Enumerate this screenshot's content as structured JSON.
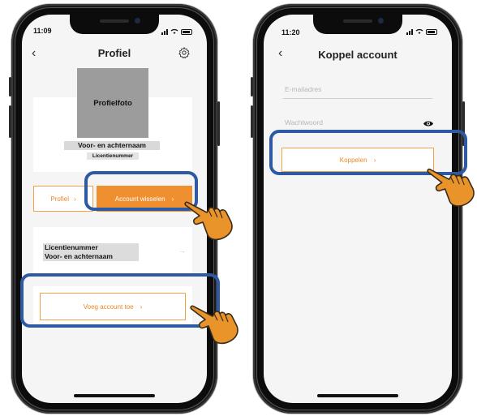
{
  "left_phone": {
    "status": {
      "time": "11:09"
    },
    "nav": {
      "title": "Profiel",
      "back_icon": "chevron-left-icon",
      "settings_icon": "gear-icon"
    },
    "profile": {
      "photo_label": "Profielfoto",
      "name": "Voor- en achternaam",
      "license": "Licentienummer"
    },
    "buttons": {
      "profile": "Profiel",
      "switch_account": "Account wisselen",
      "add_account": "Voeg account toe"
    },
    "account_row": {
      "license": "Licentienummer",
      "name": "Voor- en achternaam"
    }
  },
  "right_phone": {
    "status": {
      "time": "11:20"
    },
    "nav": {
      "title": "Koppel account",
      "back_icon": "chevron-left-icon"
    },
    "form": {
      "email_placeholder": "E-mailadres",
      "password_placeholder": "Wachtwoord",
      "eye_icon": "eye-icon",
      "submit": "Koppelen"
    }
  },
  "colors": {
    "accent": "#ef8f2f",
    "highlight": "#2d5aa3",
    "hand": "#e9942b"
  }
}
